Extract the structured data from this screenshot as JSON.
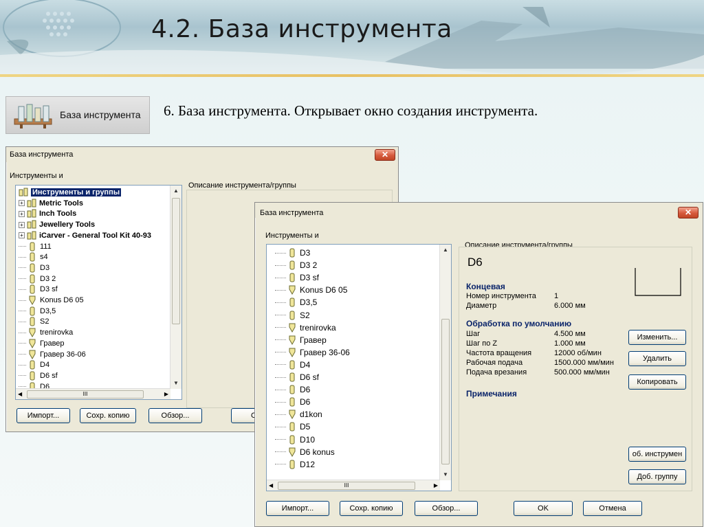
{
  "slide": {
    "title": "4.2. База инструмента",
    "caption": "6. База инструмента. Открывает окно создания инструмента."
  },
  "toolbar_button": {
    "label": "База инструмента"
  },
  "dialog_back": {
    "title": "База инструмента",
    "close": "✕",
    "tools_label": "Инструменты и",
    "desc_label": "Описание инструмента/группы",
    "tree": [
      {
        "label": "Инструменты и группы",
        "bold": true,
        "selected": true,
        "type": "root"
      },
      {
        "label": "Metric Tools",
        "bold": true,
        "type": "group"
      },
      {
        "label": "Inch Tools",
        "bold": true,
        "type": "group"
      },
      {
        "label": "Jewellery Tools",
        "bold": true,
        "type": "group"
      },
      {
        "label": "iCarver - General Tool Kit 40-93",
        "bold": true,
        "type": "group"
      },
      {
        "label": "111",
        "type": "tool"
      },
      {
        "label": "s4",
        "type": "tool"
      },
      {
        "label": "D3",
        "type": "tool"
      },
      {
        "label": "D3 2",
        "type": "tool"
      },
      {
        "label": "D3 sf",
        "type": "tool"
      },
      {
        "label": "Konus D6 05",
        "type": "cone"
      },
      {
        "label": "D3,5",
        "type": "tool"
      },
      {
        "label": "S2",
        "type": "tool"
      },
      {
        "label": "trenirovka",
        "type": "cone"
      },
      {
        "label": "Гравер",
        "type": "cone"
      },
      {
        "label": "Гравер 36-06",
        "type": "cone"
      },
      {
        "label": "D4",
        "type": "tool"
      },
      {
        "label": "D6 sf",
        "type": "tool"
      },
      {
        "label": "D6",
        "type": "tool"
      }
    ],
    "hscroll_grip": "III",
    "buttons": {
      "import": "Импорт...",
      "backup": "Сохр. копию",
      "browse": "Обзор...",
      "ok_partial": "O"
    }
  },
  "dialog_front": {
    "title": "База инструмента",
    "close": "✕",
    "tools_label": "Инструменты и",
    "desc_label": "Описание инструмента/группы",
    "tree": [
      {
        "label": "D3",
        "type": "tool"
      },
      {
        "label": "D3 2",
        "type": "tool"
      },
      {
        "label": "D3 sf",
        "type": "tool"
      },
      {
        "label": "Konus D6 05",
        "type": "cone"
      },
      {
        "label": "D3,5",
        "type": "tool"
      },
      {
        "label": "S2",
        "type": "tool"
      },
      {
        "label": "trenirovka",
        "type": "cone"
      },
      {
        "label": "Гравер",
        "type": "cone"
      },
      {
        "label": "Гравер 36-06",
        "type": "cone"
      },
      {
        "label": "D4",
        "type": "tool"
      },
      {
        "label": "D6 sf",
        "type": "tool"
      },
      {
        "label": "D6",
        "type": "tool"
      },
      {
        "label": "D6",
        "type": "tool"
      },
      {
        "label": "d1kon",
        "type": "cone"
      },
      {
        "label": "D5",
        "type": "tool"
      },
      {
        "label": "D10",
        "type": "tool"
      },
      {
        "label": "D6 konus",
        "type": "cone"
      },
      {
        "label": "D12",
        "type": "tool"
      }
    ],
    "hscroll_grip": "III",
    "info": {
      "tool_name": "D6",
      "section_type": "Концевая",
      "rows_type": [
        {
          "k": "Номер инструмента",
          "v": "1"
        },
        {
          "k": "Диаметр",
          "v": "6.000 мм"
        }
      ],
      "section_defaults": "Обработка по умолчанию",
      "rows_defaults": [
        {
          "k": "Шаг",
          "v": "4.500 мм"
        },
        {
          "k": "Шаг по Z",
          "v": "1.000 мм"
        },
        {
          "k": "Частота вращения",
          "v": "12000 об/мин"
        },
        {
          "k": "Рабочая подача",
          "v": "1500.000 мм/мин"
        },
        {
          "k": "Подача врезания",
          "v": "500.000 мм/мин"
        }
      ],
      "section_notes": "Примечания"
    },
    "side_buttons": {
      "edit": "Изменить...",
      "delete": "Удалить",
      "copy": "Копировать",
      "add_tool": "об. инструмен",
      "add_group": "Доб. группу"
    },
    "buttons": {
      "import": "Импорт...",
      "backup": "Сохр. копию",
      "browse": "Обзор...",
      "ok": "OK",
      "cancel": "Отмена"
    }
  }
}
